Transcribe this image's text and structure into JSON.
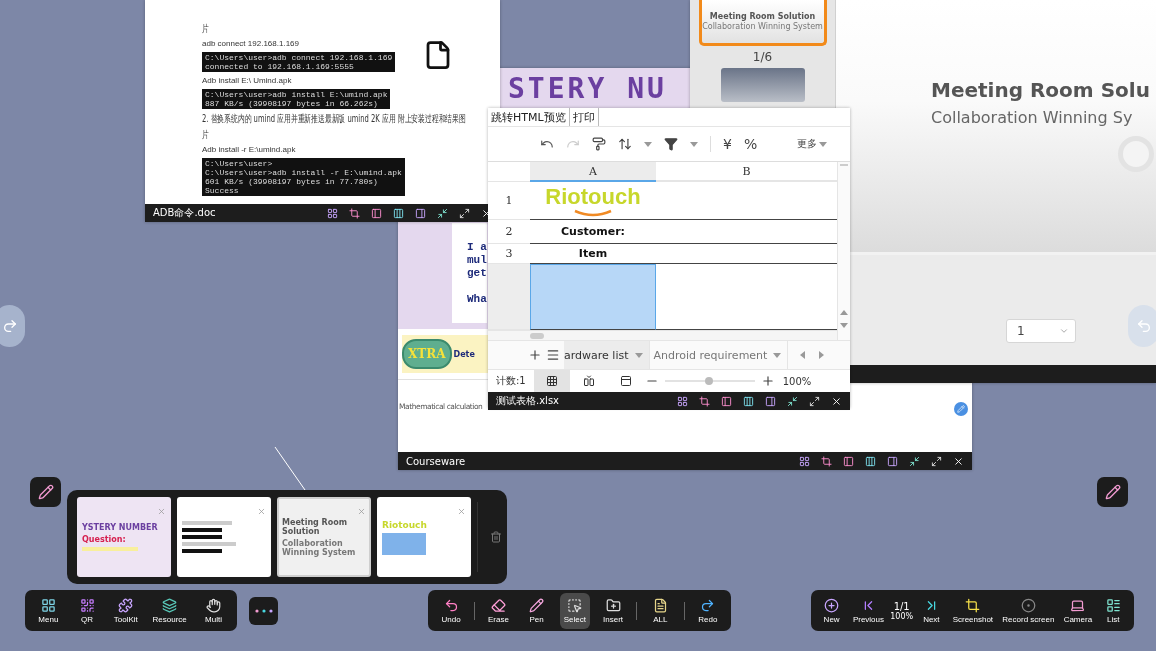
{
  "doc_window": {
    "title": "ADB命令.doc",
    "blocks": [
      {
        "kind": "cjk",
        "text": "片"
      },
      {
        "kind": "text",
        "text": "adb connect 192.168.1.169"
      },
      {
        "kind": "terminal",
        "lines": [
          "C:\\Users\\user>adb connect 192.168.1.169",
          "connected to 192.168.1.169:5555"
        ]
      },
      {
        "kind": "text",
        "text": "Adb install E:\\ Umind.apk"
      },
      {
        "kind": "terminal",
        "lines": [
          "C:\\Users\\user>adb install E:\\umind.apk",
          "887 KB/s (39908197 bytes in 66.262s)"
        ]
      },
      {
        "kind": "cjk",
        "text": "2.   替换系统内的 umind 应用并重新推送最新版 umind 2K 应用 附上安装过程和结果图"
      },
      {
        "kind": "cjk",
        "text": "片"
      },
      {
        "kind": "text",
        "text": "Adb install -r E:\\umind.apk"
      },
      {
        "kind": "terminal",
        "lines": [
          "C:\\Users\\user>",
          "C:\\Users\\user>adb install -r E:\\umind.apk",
          "601 KB/s (39908197 bytes in 77.780s)",
          "Success"
        ]
      }
    ]
  },
  "courseware_window": {
    "title": "Courseware",
    "heading": "STERY NU",
    "lines": [
      "I a",
      "mul",
      "get"
    ],
    "question": "Wha",
    "badge": "XTRA",
    "badge_caption": "Dete",
    "footer": "Mathematical calculation"
  },
  "presentation_window": {
    "thumb_title": "Meeting Room Solution",
    "thumb_subtitle": "Collaboration Winning System",
    "page_indicator": "1/6",
    "slide_title": "Meeting Room Solu",
    "slide_subtitle": "Collaboration Winning Sy",
    "page_select": "1"
  },
  "spreadsheet_window": {
    "title": "测试表格.xlsx",
    "menu": [
      "跳转HTML预览",
      "打印"
    ],
    "toolbar": {
      "redo_disabled": true,
      "currency": "¥",
      "percent": "%",
      "more": "更多"
    },
    "columns": [
      {
        "label": "A",
        "selected": true
      },
      {
        "label": "B",
        "selected": false
      }
    ],
    "rows": [
      {
        "number": "1",
        "kind": "logo",
        "value": "Riotouch",
        "selected": false
      },
      {
        "number": "2",
        "kind": "text",
        "value": "Customer:",
        "selected": false
      },
      {
        "number": "3",
        "kind": "text",
        "value": "Item",
        "selected": false
      },
      {
        "kind": "tall",
        "selected": true
      }
    ],
    "sheets": [
      {
        "label": "ardware list",
        "selected": true
      },
      {
        "label": "Android requirement",
        "selected": false
      }
    ],
    "status": {
      "count": "计数:1",
      "zoom": "100%",
      "level": 0.49
    }
  },
  "thumbnails": [
    {
      "kind": "courseware",
      "title": "YSTERY NUMBER",
      "subtitle": "Question:",
      "selected": false
    },
    {
      "kind": "document",
      "selected": false
    },
    {
      "kind": "slide",
      "title": "Meeting Room Solution",
      "subtitle": "Collaboration Winning System",
      "selected": true
    },
    {
      "kind": "sheet",
      "title": "Riotouch",
      "selected": false
    }
  ],
  "left_toolbar": {
    "items": [
      {
        "kind": "menu",
        "label": "Menu"
      },
      {
        "kind": "qr",
        "label": "QR"
      },
      {
        "kind": "toolkit",
        "label": "ToolKit"
      },
      {
        "kind": "resource",
        "label": "Resource"
      },
      {
        "kind": "multi",
        "label": "Multi"
      }
    ]
  },
  "main_toolbar": {
    "items": [
      {
        "kind": "undo",
        "label": "Undo",
        "selected": false
      },
      {
        "kind": "separator"
      },
      {
        "kind": "erase",
        "label": "Erase",
        "selected": false
      },
      {
        "kind": "pen",
        "label": "Pen",
        "selected": false
      },
      {
        "kind": "select",
        "label": "Select",
        "selected": true
      },
      {
        "kind": "insert",
        "label": "Insert",
        "selected": false
      },
      {
        "kind": "separator"
      },
      {
        "kind": "all",
        "label": "ALL",
        "selected": false
      },
      {
        "kind": "separator"
      },
      {
        "kind": "redo",
        "label": "Redo",
        "selected": false
      }
    ]
  },
  "right_toolbar": {
    "items": [
      {
        "kind": "new",
        "label": "New"
      },
      {
        "kind": "previous",
        "label": "Previous"
      },
      {
        "kind": "page",
        "label": "1/1",
        "sublabel": "100%"
      },
      {
        "kind": "next",
        "label": "Next"
      },
      {
        "kind": "screenshot",
        "label": "Screenshot"
      },
      {
        "kind": "record",
        "label": "Record screen"
      },
      {
        "kind": "camera",
        "label": "Camera"
      },
      {
        "kind": "list",
        "label": "List"
      }
    ]
  }
}
